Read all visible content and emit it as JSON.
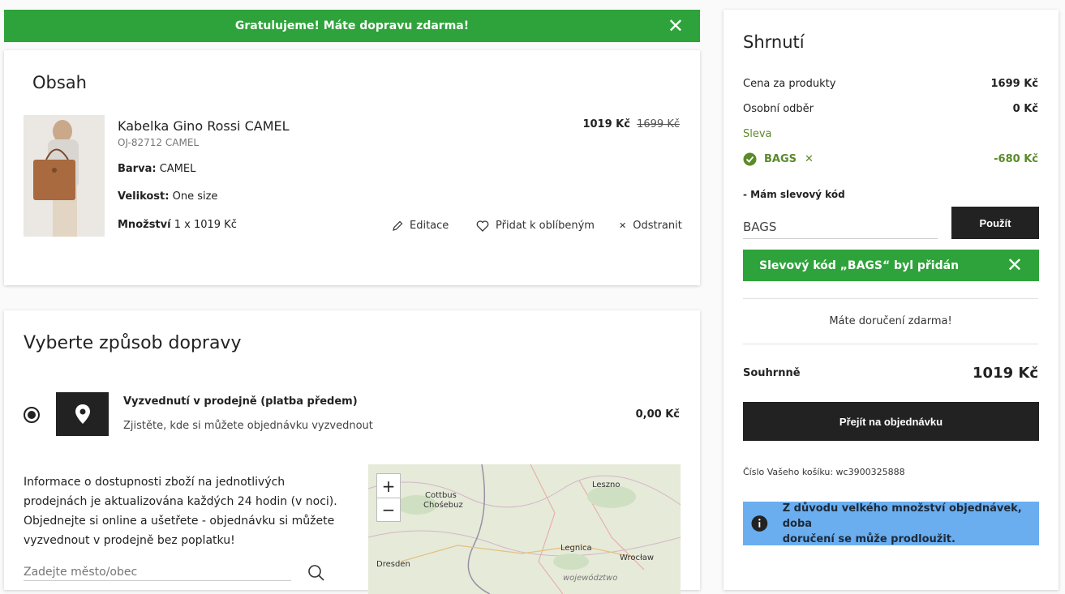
{
  "free_shipping_banner": {
    "text": "Gratulujeme! Máte dopravu zdarma!"
  },
  "content": {
    "title": "Obsah",
    "product": {
      "name": "Kabelka Gino Rossi CAMEL",
      "sku": "OJ-82712 CAMEL",
      "color_label": "Barva:",
      "color_value": "CAMEL",
      "size_label": "Velikost:",
      "size_value": "One size",
      "qty_label": "Množství",
      "qty_value": "1 x 1019 Kč",
      "price": "1019 Kč",
      "old_price": "1699 Kč",
      "actions": {
        "edit": "Editace",
        "favorite": "Přidat k oblíbeným",
        "remove": "Odstranit"
      }
    }
  },
  "delivery": {
    "title": "Vyberte způsob dopravy",
    "option": {
      "name": "Vyzvednutí v prodejně (platba předem)",
      "description": "Zjistěte, kde si můžete objednávku vyzvednout",
      "price": "0,00 Kč"
    },
    "info_lines": [
      "Informace o dostupnosti zboží na jednotlivých",
      "prodejnách je aktualizována každých 24 hodin (v noci).",
      "Objednejte si online a ušetřete - objednávku si můžete",
      "vyzvednout v prodejně bez poplatku!"
    ],
    "city_placeholder": "Zadejte město/obec",
    "map": {
      "zoom_in": "+",
      "zoom_out": "−",
      "labels": {
        "cottbus": "Cottbus",
        "chosebuz": "Chośebuz",
        "leszno": "Leszno",
        "legnica": "Legnica",
        "wroclaw": "Wrocław",
        "dresden": "Dresden",
        "wojewodztwo": "województwo"
      }
    }
  },
  "summary": {
    "title": "Shrnutí",
    "products_label": "Cena za produkty",
    "products_value": "1699 Kč",
    "pickup_label": "Osobní odběr",
    "pickup_value": "0 Kč",
    "discount_label": "Sleva",
    "coupon_code": "BAGS",
    "coupon_remove": "✕",
    "coupon_value": "-680 Kč",
    "have_code_label": "- Mám slevový kód",
    "code_input_value": "BAGS",
    "apply_button": "Použít",
    "code_added_banner": "Slevový kód „BAGS“ byl přidán",
    "free_delivery_text": "Máte doručení zdarma!",
    "total_label": "Souhrnně",
    "total_value": "1019 Kč",
    "checkout_button": "Přejít na objednávku",
    "cart_number": "Číslo Vašeho košíku: wc3900325888",
    "notice_text_1": "Z důvodu velkého množství objednávek, doba",
    "notice_text_2": "doručení se může prodloužit."
  },
  "colors": {
    "green": "#2fa33b",
    "dark": "#222222",
    "discount_green": "#5a8a2a",
    "notice_blue": "#6aaef0"
  }
}
